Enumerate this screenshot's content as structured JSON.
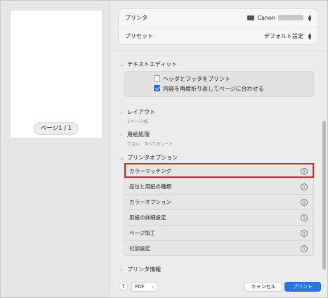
{
  "preview": {
    "page_indicator": "ページ1 / 1"
  },
  "top": {
    "printer_label": "プリンタ",
    "printer_value": "Canon",
    "preset_label": "プリセット",
    "preset_value": "デフォルト設定"
  },
  "text_edit": {
    "header": "テキストエディット",
    "option1": "ヘッダとフッタをプリント",
    "option1_checked": false,
    "option2": "内容を再度折り返してページに合わせる",
    "option2_checked": true
  },
  "layout": {
    "header": "レイアウト",
    "summary": "1ページ/枚"
  },
  "paper_handling": {
    "header": "用紙処理",
    "summary": "丁合い、すべてのシート"
  },
  "printer_options": {
    "header": "プリンタオプション",
    "items": [
      "カラーマッチング",
      "品位と用紙の種類",
      "カラーオプション",
      "用紙の詳細設定",
      "ページ加工",
      "付加設定"
    ],
    "info_icon": "i",
    "highlight_color": "#d7262a"
  },
  "printer_info": {
    "header": "プリンタ情報"
  },
  "bottom": {
    "help": "?",
    "pdf": "PDF",
    "cancel": "キャンセル",
    "print": "プリント",
    "accent": "#2d74e4"
  }
}
